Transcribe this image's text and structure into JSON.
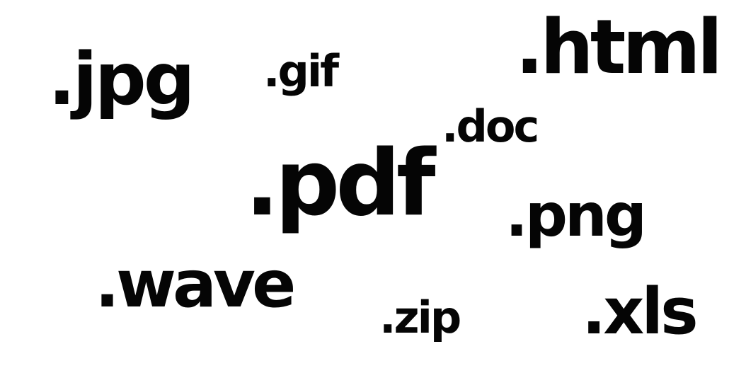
{
  "extensions": {
    "jpg": ".jpg",
    "gif": ".gif",
    "html": ".html",
    "doc": ".doc",
    "pdf": ".pdf",
    "png": ".png",
    "wave": ".wave",
    "zip": ".zip",
    "xls": ".xls"
  },
  "colors": {
    "text": "#050505",
    "background": "#ffffff"
  }
}
